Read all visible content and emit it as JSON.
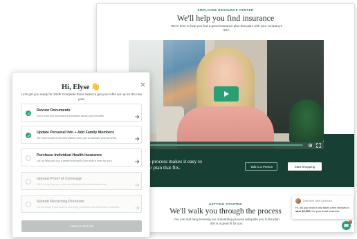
{
  "landing": {
    "eyebrow": "EMPLOYEE RESOURCE CENTER",
    "title": "We'll help you find insurance",
    "subtitle": "We're here to help you find a great insurance plan that pairs with your company's HRA.",
    "band_text": "...step process makes it easy to ...ance plan that fits.",
    "talk_button": "Talk to a Person",
    "shop_button": "Start Shopping",
    "section_eyebrow": "GETTING STARTED",
    "section_title": "We'll walk you through the process",
    "section_subtitle": "You can rest easy knowing our onboarding process will guide you to the plan that is a great fit for you."
  },
  "video": {
    "progress_percent": 0,
    "play_icon": "play-icon",
    "settings_icon": "gear-icon",
    "fullscreen_icon": "fullscreen-icon"
  },
  "chat": {
    "from": "Leah from Take Command",
    "message_prefix": "Hi, did you know it only takes a few minutes to ",
    "message_bold": "save $2,000+",
    "message_suffix": " for your small business.",
    "badge_count": "1",
    "fab_icon": "chat-icon"
  },
  "modal": {
    "greeting": "Hi, Elyse 👋",
    "subtitle": "Let's get you ready for 2020! Complete these tasks to get your HRA set up for the new year.",
    "tasks": [
      {
        "title": "Review Documents",
        "desc": "Don't miss this important information about your benefits.",
        "status": "done"
      },
      {
        "title": "Update Personal Info + Add Family Members",
        "desc": "We need some more information from you to activate your benefits.",
        "status": "done"
      },
      {
        "title": "Purchase Individual Health Insurance",
        "desc": "Let us help pick out a health insurance plan that is best for you!",
        "status": "todo"
      },
      {
        "title": "Upload Proof of Coverage",
        "desc": "We'll verify that your plan qualifies you for reimbursements.",
        "status": "disabled"
      },
      {
        "title": "Submit Recurring Premium",
        "desc": "Let us know if you have a recurring premium you would like to submit.",
        "status": "disabled"
      }
    ],
    "finish_button": "FINISH SETUP"
  },
  "colors": {
    "brand_green": "#173f33",
    "accent_green": "#2a9f74",
    "check_green": "#34a278",
    "disabled_gray": "#bfc3c1"
  }
}
